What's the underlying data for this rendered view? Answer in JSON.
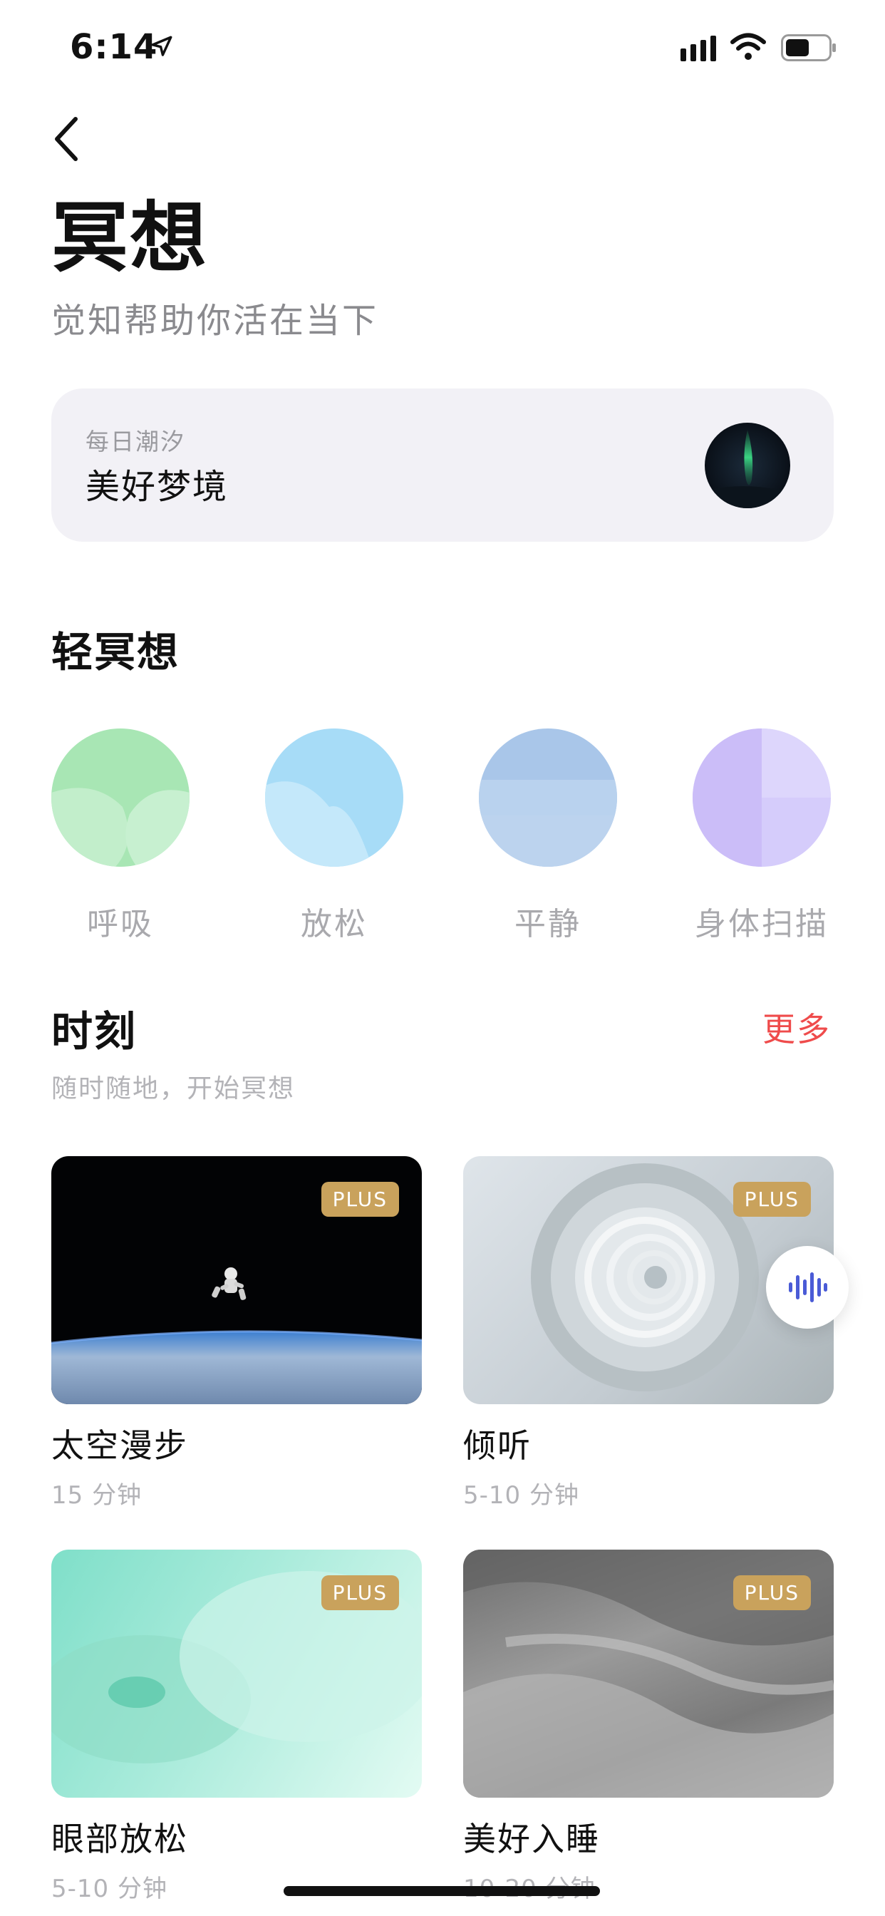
{
  "status_bar": {
    "time": "6:14"
  },
  "header": {
    "title": "冥想",
    "subtitle": "觉知帮助你活在当下"
  },
  "daily": {
    "eyebrow": "每日潮汐",
    "title": "美好梦境"
  },
  "light_meditation": {
    "title": "轻冥想",
    "items": [
      {
        "label": "呼吸"
      },
      {
        "label": "放松"
      },
      {
        "label": "平静"
      },
      {
        "label": "身体扫描"
      }
    ]
  },
  "moments": {
    "title": "时刻",
    "subtitle": "随时随地，开始冥想",
    "more_label": "更多",
    "cards": [
      {
        "title": "太空漫步",
        "duration": "15 分钟",
        "badge": "PLUS"
      },
      {
        "title": "倾听",
        "duration": "5-10 分钟",
        "badge": "PLUS"
      },
      {
        "title": "眼部放松",
        "duration": "5-10 分钟",
        "badge": "PLUS"
      },
      {
        "title": "美好入睡",
        "duration": "10-20 分钟",
        "badge": "PLUS"
      }
    ]
  },
  "colors": {
    "accent_red": "#ef4b4b",
    "plus_gold": "#c9a25c",
    "card_bg": "#f2f1f6",
    "voice_blue": "#4a5bd6"
  },
  "icons": [
    "location-arrow-icon",
    "signal-icon",
    "wifi-icon",
    "battery-icon",
    "back-chevron-icon",
    "voice-wave-icon"
  ]
}
